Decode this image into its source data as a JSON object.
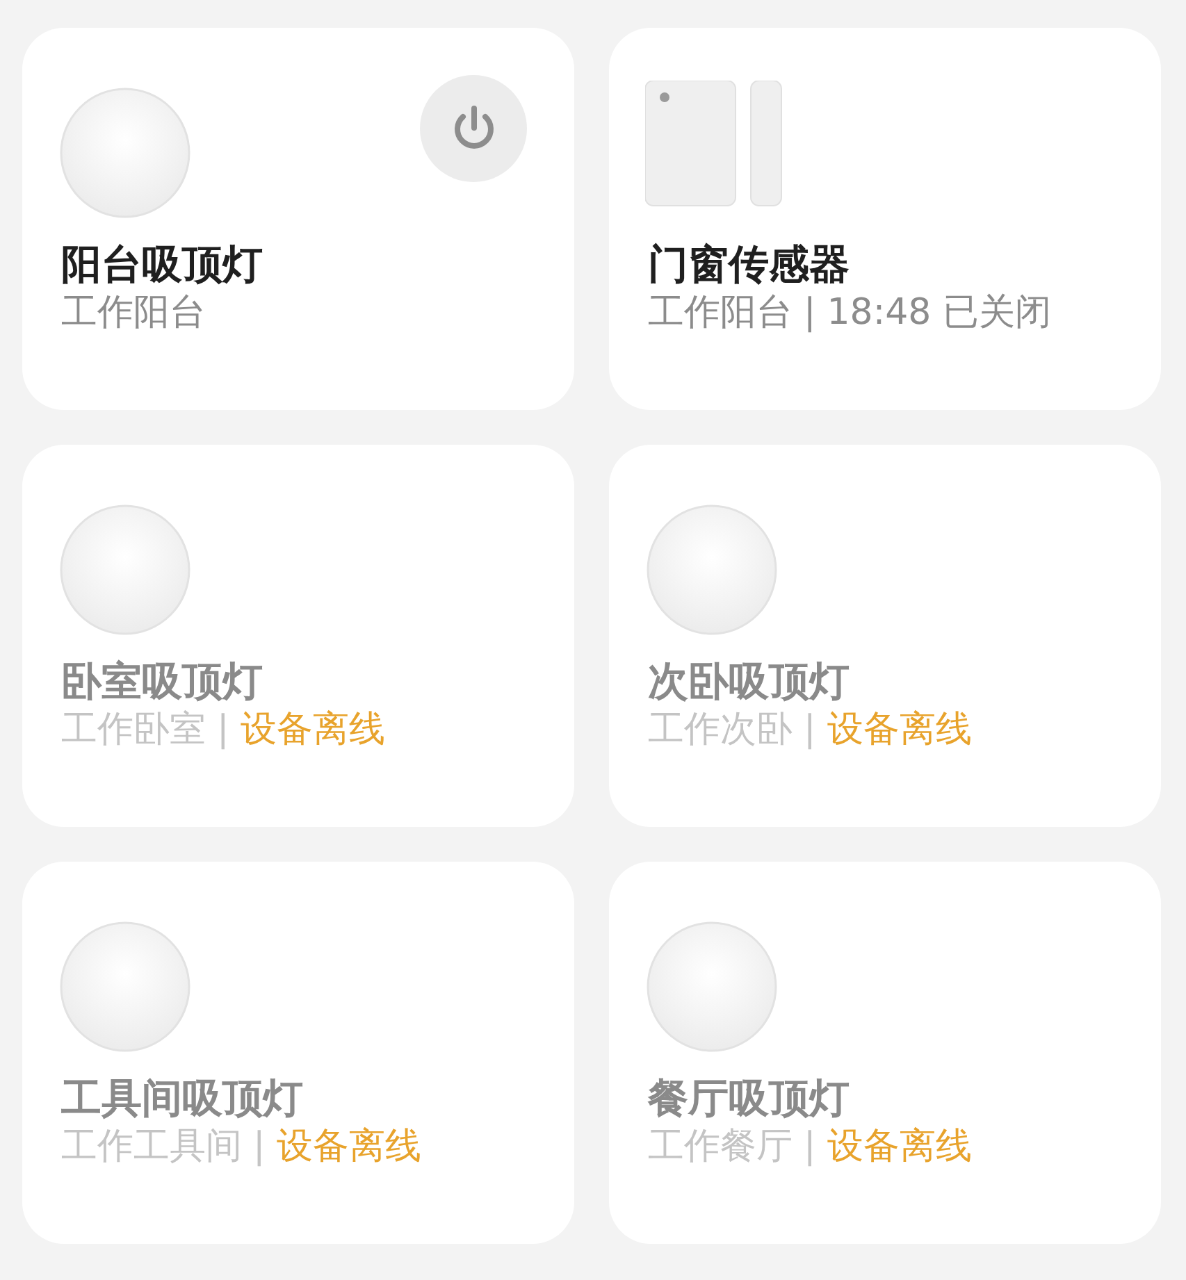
{
  "devices": [
    {
      "kind": "light",
      "name": "阳台吸顶灯",
      "room": "工作阳台",
      "offline": false,
      "power_button": true
    },
    {
      "kind": "door-sensor",
      "name": "门窗传感器",
      "room": "工作阳台",
      "separator": "|",
      "status": "18:48 已关闭",
      "offline": false,
      "power_button": false
    },
    {
      "kind": "light",
      "name": "卧室吸顶灯",
      "room": "工作卧室",
      "separator": "|",
      "status": "设备离线",
      "offline": true,
      "power_button": false
    },
    {
      "kind": "light",
      "name": "次卧吸顶灯",
      "room": "工作次卧",
      "separator": "|",
      "status": "设备离线",
      "offline": true,
      "power_button": false
    },
    {
      "kind": "light",
      "name": "工具间吸顶灯",
      "room": "工作工具间",
      "separator": "|",
      "status": "设备离线",
      "offline": true,
      "power_button": false
    },
    {
      "kind": "light",
      "name": "餐厅吸顶灯",
      "room": "工作餐厅",
      "separator": "|",
      "status": "设备离线",
      "offline": true,
      "power_button": false
    }
  ]
}
